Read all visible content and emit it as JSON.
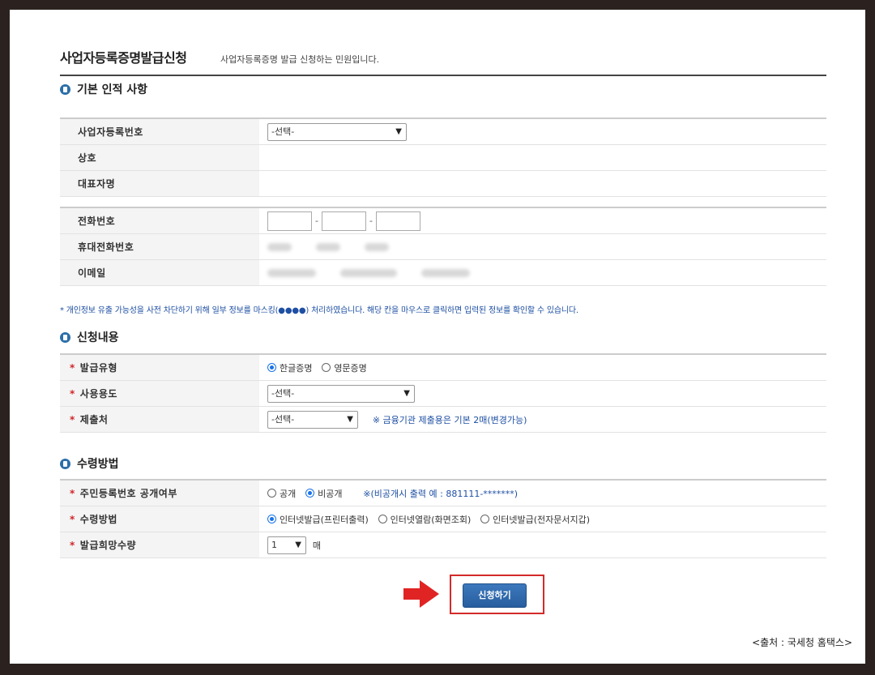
{
  "header": {
    "title": "사업자등록증명발급신청",
    "description": "사업자등록증명 발급 신청하는 민원입니다."
  },
  "section_basic": {
    "heading": "기본 인적 사항",
    "rows": [
      {
        "label": "사업자등록번호",
        "select_value": "-선택-"
      },
      {
        "label": "상호"
      },
      {
        "label": "대표자명"
      }
    ],
    "contact_rows": [
      {
        "label": "전화번호",
        "separator": "-"
      },
      {
        "label": "휴대전화번호"
      },
      {
        "label": "이메일"
      }
    ],
    "privacy_note": "* 개인정보 유출 가능성을 사전 차단하기 위해 일부 정보를 마스킹(●●●●) 처리하였습니다. 해당 칸을 마우스로 클릭하면 입력된 정보를 확인할 수 있습니다."
  },
  "section_request": {
    "heading": "신청내용",
    "issue_type": {
      "label": "발급유형",
      "options": [
        "한글증명",
        "영문증명"
      ],
      "selected": "한글증명"
    },
    "purpose": {
      "label": "사용용도",
      "select_value": "-선택-"
    },
    "submit_to": {
      "label": "제출처",
      "select_value": "-선택-",
      "note": "※ 금융기관 제출용은 기본 2매(변경가능)"
    }
  },
  "section_receipt": {
    "heading": "수령방법",
    "disclose": {
      "label": "주민등록번호 공개여부",
      "options": [
        "공개",
        "비공개"
      ],
      "selected": "비공개",
      "note": "※(비공개시 출력 예 : 881111-*******)"
    },
    "method": {
      "label": "수령방법",
      "options": [
        "인터넷발급(프린터출력)",
        "인터넷열람(화면조회)",
        "인터넷발급(전자문서지갑)"
      ],
      "selected": "인터넷발급(프린터출력)"
    },
    "count": {
      "label": "발급희망수량",
      "value": "1",
      "unit": "매"
    }
  },
  "actions": {
    "submit_label": "신청하기"
  },
  "source_caption": "<출처 : 국세청 홈택스>",
  "colors": {
    "accent_blue": "#2c6fa8",
    "highlight_red": "#d42a2a",
    "required_red": "#d0262b"
  }
}
